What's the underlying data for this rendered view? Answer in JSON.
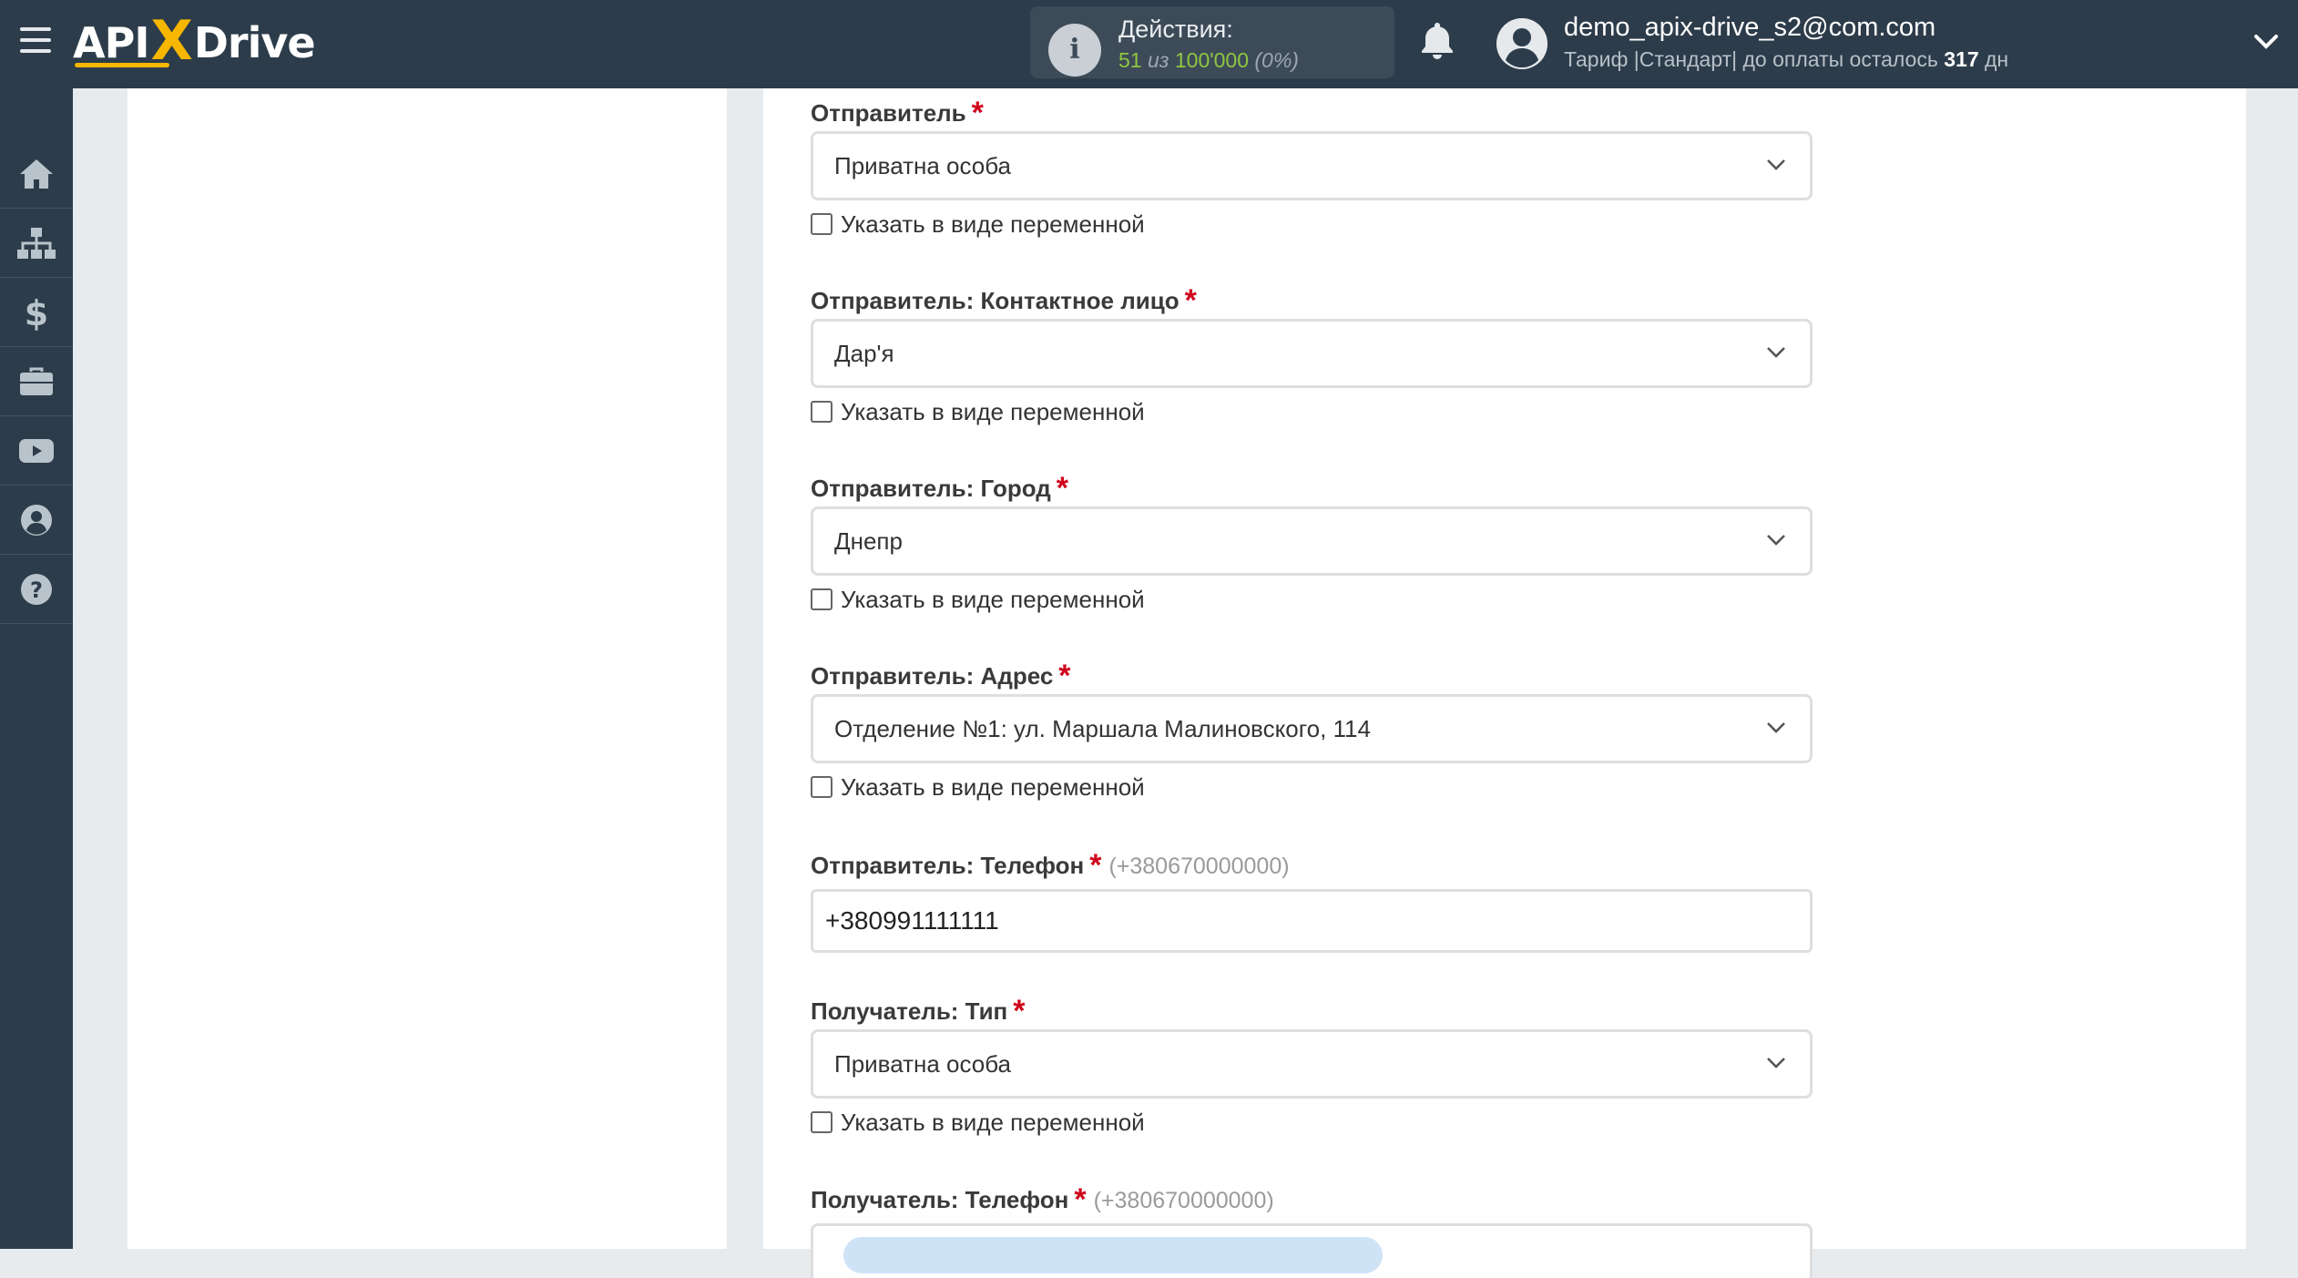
{
  "header": {
    "logo": {
      "left": "API",
      "x": "X",
      "right": "Drive"
    },
    "actions": {
      "label": "Действия:",
      "used": "51",
      "of": "из",
      "total": "100'000",
      "percent": "(0%)"
    },
    "user": {
      "email": "demo_apix-drive_s2@com.com",
      "plan_prefix": "Тариф |Стандарт| до оплаты осталось",
      "days": "317",
      "days_unit": "дн"
    }
  },
  "sidebar": {
    "items": [
      {
        "name": "home-icon"
      },
      {
        "name": "sitemap-icon"
      },
      {
        "name": "dollar-icon"
      },
      {
        "name": "briefcase-icon"
      },
      {
        "name": "youtube-icon"
      },
      {
        "name": "user-icon"
      },
      {
        "name": "help-icon"
      }
    ]
  },
  "form": {
    "checkbox_label": "Указать в виде переменной",
    "required_mark": "*",
    "sender_type": {
      "label": "Отправитель",
      "value": "Приватна особа"
    },
    "sender_contact": {
      "label": "Отправитель: Контактное лицо",
      "value": "Дар'я"
    },
    "sender_city": {
      "label": "Отправитель: Город",
      "value": "Днепр"
    },
    "sender_address": {
      "label": "Отправитель: Адрес",
      "value": "Отделение №1: ул. Маршала Малиновского, 114"
    },
    "sender_phone": {
      "label": "Отправитель: Телефон",
      "hint": "(+380670000000)",
      "value": "+380991111111"
    },
    "recipient_type": {
      "label": "Получатель: Тип",
      "value": "Приватна особа"
    },
    "recipient_phone": {
      "label": "Получатель: Телефон",
      "hint": "(+380670000000)"
    }
  },
  "colors": {
    "topbar": "#2d3c4a",
    "accent": "#f7b600",
    "required": "#d0021b",
    "green": "#8fc641"
  }
}
